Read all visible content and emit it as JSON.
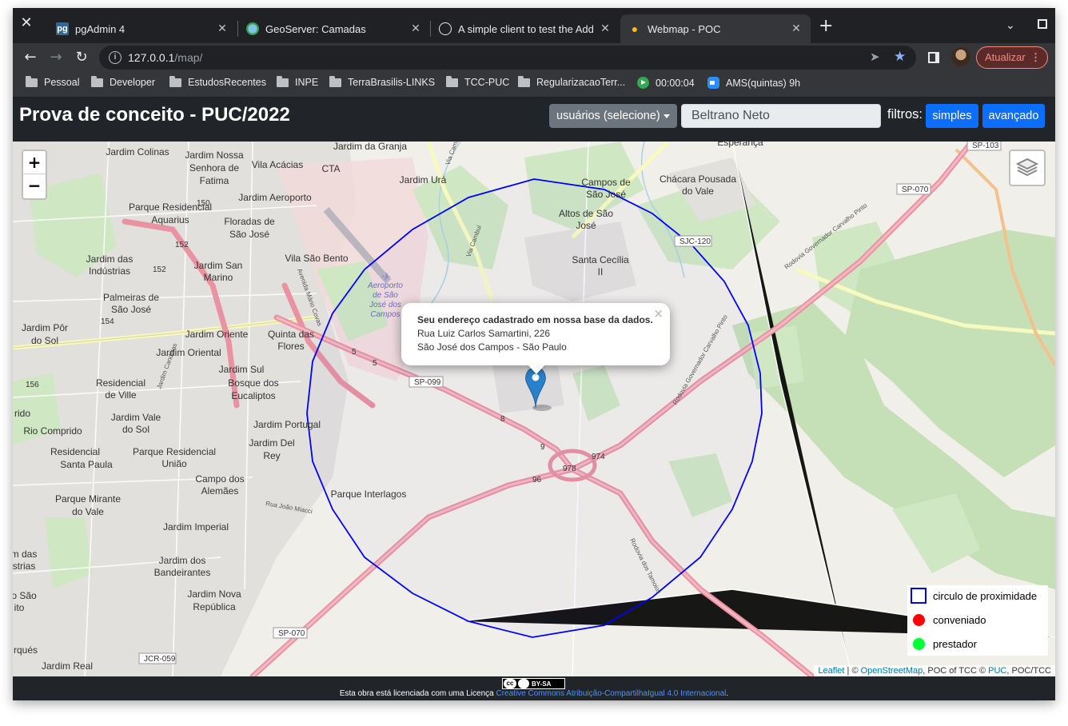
{
  "browser": {
    "tabs": [
      {
        "title": "pgAdmin 4",
        "icon": "pgadmin-icon"
      },
      {
        "title": "GeoServer: Camadas",
        "icon": "geoserver-icon"
      },
      {
        "title": "A simple client to test the Addre",
        "icon": "globe-icon"
      },
      {
        "title": "Webmap - POC",
        "icon": "lightbulb-icon",
        "active": true
      }
    ],
    "url_host": "127.0.0.1",
    "url_path": "/map/",
    "update_label": "Atualizar",
    "bookmarks": [
      {
        "label": "Pessoal",
        "icon": "folder-icon"
      },
      {
        "label": "Developer",
        "icon": "folder-icon"
      },
      {
        "label": "EstudosRecentes",
        "icon": "folder-icon"
      },
      {
        "label": "INPE",
        "icon": "folder-icon"
      },
      {
        "label": "TerraBrasilis-LINKS",
        "icon": "folder-icon"
      },
      {
        "label": "TCC-PUC",
        "icon": "folder-icon"
      },
      {
        "label": "RegularizacaoTerr...",
        "icon": "folder-icon"
      },
      {
        "label": "00:00:04",
        "icon": "play-icon"
      },
      {
        "label": "AMS(quintas) 9h",
        "icon": "zoom-icon"
      }
    ]
  },
  "app": {
    "title": "Prova de conceito - PUC/2022",
    "user_select_label": "usuários (selecione)",
    "name_value": "Beltrano Neto",
    "filters_label": "filtros:",
    "simple_button": "simples",
    "advanced_button": "avançado"
  },
  "map": {
    "zoom_in": "+",
    "zoom_out": "−",
    "popup": {
      "heading": "Seu endereço cadastrado em nossa base da dados.",
      "line1": "Rua Luiz Carlos Samartini, 226",
      "line2": "São José dos Campos - São Paulo",
      "close": "×"
    },
    "legend": [
      {
        "label": "circulo de proximidade",
        "kind": "square",
        "color": "#0000ff"
      },
      {
        "label": "conveniado",
        "kind": "dot",
        "color": "#ff0000"
      },
      {
        "label": "prestador",
        "kind": "dot",
        "color": "#00ff33"
      }
    ],
    "attribution": {
      "leaflet": "Leaflet",
      "sep1": " | © ",
      "osm": "OpenStreetMap",
      "mid": ", POC of TCC © ",
      "puc": "PUC",
      "end": ", POC/TCC"
    },
    "place_labels": [
      "Jardim Colinas",
      "Jardim Nossa",
      "Senhora de",
      "Fatima",
      "Vila Acácias",
      "CTA",
      "Jardim da Granja",
      "Jardim Urá",
      "Esperança",
      "Campos de",
      "São José",
      "Chácara Pousada",
      "do Vale",
      "Jardim Aeroporto",
      "Parque Residencial",
      "Aquarius",
      "Floradas de",
      "São José",
      "Altos de São",
      "José",
      "Santa Cecília",
      "II",
      "Jardim das",
      "Indústrias",
      "Jardim San",
      "Marino",
      "Vila São Bento",
      "Aeroporto",
      "de São",
      "José dos",
      "Campos",
      "Palmeiras de",
      "São José",
      "Jardim Pôr",
      "do Sol",
      "Jardim Oriente",
      "Quinta das",
      "Flores",
      "Jardim Oriental",
      "Jardim Sul",
      "Bosque dos",
      "Eucaliptos",
      "Residencial",
      "de Ville",
      "rido",
      "Jardim Vale",
      "do Sol",
      "Rio Comprido",
      "Jardim Portugal",
      "Jardim Del",
      "Rey",
      "Residencial",
      "Santa Paula",
      "Parque Residencial",
      "União",
      "Campo dos",
      "Alemães",
      "Parque Interlagos",
      "Parque Mirante",
      "do Vale",
      "Jardim Imperial",
      "Jardim dos",
      "Bandeirantes",
      "Jardim Nova",
      "República",
      "Jardim Real",
      "m das",
      "strias",
      "o São",
      "ito",
      "rqués"
    ],
    "road_labels": [
      "SP-099",
      "SP-070",
      "SP-070",
      "SP-103",
      "SJC-120",
      "JCR-059",
      "974",
      "978",
      "96",
      "152",
      "152",
      "150",
      "154",
      "156",
      "5",
      "5",
      "8",
      "9",
      "Rodovia Governador Carvalho Pinto",
      "Rodovia Governador Carvalho Pinto",
      "Rodovia dos Tamoios",
      "Avenida Mário Covas",
      "Via Cambuí",
      "Via Cambuí",
      "Jardim Candeias",
      "Rua João Miacci"
    ]
  },
  "footer": {
    "cc_label": "BY-SA",
    "text_prefix": "Esta obra está licenciada com uma Licença ",
    "link": "Creative Commons Atribuição-CompartilhaIgual 4.0 Internacional",
    "text_suffix": "."
  }
}
